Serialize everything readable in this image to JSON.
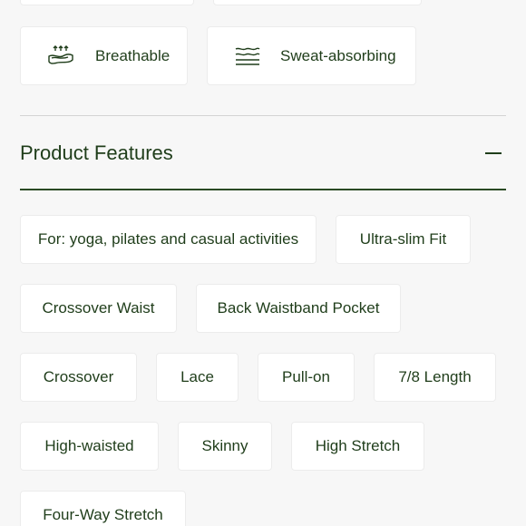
{
  "attributes": [
    {
      "label": "Breathable",
      "icon": "breathable-icon"
    },
    {
      "label": "Sweat-absorbing",
      "icon": "sweat-absorbing-icon"
    }
  ],
  "section": {
    "title": "Product Features",
    "toggle_icon": "minus-icon"
  },
  "features": [
    "For: yoga, pilates and casual activities",
    "Ultra-slim Fit",
    "Crossover Waist",
    "Back Waistband Pocket",
    "Crossover",
    "Lace",
    "Pull-on",
    "7/8 Length",
    "High-waisted",
    "Skinny",
    "High Stretch",
    "Four-Way Stretch"
  ]
}
